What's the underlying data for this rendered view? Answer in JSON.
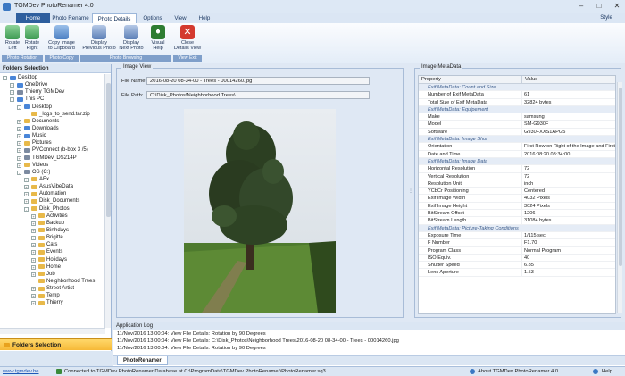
{
  "window": {
    "title": "TGMDev PhotoRenamer 4.0"
  },
  "menu": {
    "tabs": [
      {
        "label": "Home"
      },
      {
        "label": "Photo Rename"
      },
      {
        "label": "Photo Details"
      },
      {
        "label": "Options"
      },
      {
        "label": "View"
      },
      {
        "label": "Help"
      }
    ],
    "style_label": "Style"
  },
  "ribbon": {
    "buttons": [
      {
        "label1": "Rotate",
        "label2": "Left"
      },
      {
        "label1": "Rotate",
        "label2": "Right"
      },
      {
        "label1": "Copy Image",
        "label2": "to Clipboard"
      },
      {
        "label1": "Display",
        "label2": "Previous Photo"
      },
      {
        "label1": "Display",
        "label2": "Next Photo"
      },
      {
        "label1": "Visual",
        "label2": "Help"
      },
      {
        "label1": "Close",
        "label2": "Details View"
      }
    ],
    "groups": [
      {
        "label": "Photo Rotation"
      },
      {
        "label": "Photo Copy"
      },
      {
        "label": "Photo Browsing"
      },
      {
        "label": "View Exit"
      }
    ]
  },
  "folders": {
    "header": "Folders Selection",
    "bottom_label": "Folders Selection",
    "tree": [
      {
        "label": "Desktop",
        "exp": "-",
        "color": "#4a86d8"
      },
      {
        "label": "OneDrive",
        "exp": "+",
        "color": "#4a86d8"
      },
      {
        "label": "Thierry TGMDev",
        "exp": "+",
        "color": "#7c8aa0"
      },
      {
        "label": "This PC",
        "exp": "-",
        "color": "#4a86d8"
      },
      {
        "label": "Desktop",
        "exp": "-",
        "color": "#4a86d8"
      },
      {
        "label": "_logs_to_send.tar.zip",
        "exp": "",
        "color": "#e8b94a"
      },
      {
        "label": "Documents",
        "exp": "+",
        "color": "#e8b94a"
      },
      {
        "label": "Downloads",
        "exp": "+",
        "color": "#4a86d8"
      },
      {
        "label": "Music",
        "exp": "+",
        "color": "#4a86d8"
      },
      {
        "label": "Pictures",
        "exp": "+",
        "color": "#e8b94a"
      },
      {
        "label": "PVConnect (b-box 3 /5)",
        "exp": "+",
        "color": "#7c8aa0"
      },
      {
        "label": "TGMDev_DS214P",
        "exp": "+",
        "color": "#7c8aa0"
      },
      {
        "label": "Videos",
        "exp": "+",
        "color": "#e8b94a"
      },
      {
        "label": "OS (C:)",
        "exp": "-",
        "color": "#7c8aa0"
      },
      {
        "label": "AEx",
        "exp": "+",
        "color": "#e8b94a"
      },
      {
        "label": "AsusVibeData",
        "exp": "+",
        "color": "#e8b94a"
      },
      {
        "label": "Automation",
        "exp": "+",
        "color": "#e8b94a"
      },
      {
        "label": "Disk_Documents",
        "exp": "+",
        "color": "#e8b94a"
      },
      {
        "label": "Disk_Photos",
        "exp": "-",
        "color": "#e8b94a"
      },
      {
        "label": "Activities",
        "exp": "+",
        "color": "#e8b94a"
      },
      {
        "label": "Backup",
        "exp": "+",
        "color": "#e8b94a"
      },
      {
        "label": "Birthdays",
        "exp": "+",
        "color": "#e8b94a"
      },
      {
        "label": "Brigitte",
        "exp": "+",
        "color": "#e8b94a"
      },
      {
        "label": "Cats",
        "exp": "+",
        "color": "#e8b94a"
      },
      {
        "label": "Events",
        "exp": "+",
        "color": "#e8b94a"
      },
      {
        "label": "Holidays",
        "exp": "+",
        "color": "#e8b94a"
      },
      {
        "label": "Home",
        "exp": "+",
        "color": "#e8b94a"
      },
      {
        "label": "Job",
        "exp": "+",
        "color": "#e8b94a"
      },
      {
        "label": "Neighborhood Trees",
        "exp": "",
        "color": "#e8b94a"
      },
      {
        "label": "Street Artist",
        "exp": "+",
        "color": "#e8b94a"
      },
      {
        "label": "Temp",
        "exp": "+",
        "color": "#e8b94a"
      },
      {
        "label": "Thierry",
        "exp": "+",
        "color": "#e8b94a"
      }
    ]
  },
  "image_view": {
    "title": "Image View",
    "file_name_label": "File Name:",
    "file_name": "2016-08-20 08-34-00 - Trees - 00014260.jpg",
    "file_path_label": "File Path:",
    "file_path": "C:\\Disk_Photos\\Neighborhood Trees\\"
  },
  "metadata": {
    "title": "Image MetaData",
    "col_property": "Property",
    "col_value": "Value",
    "rows": [
      {
        "section": "Exif MetaData: Count and Size"
      },
      {
        "p": "Number of Exif MetaData",
        "v": "61"
      },
      {
        "p": "Total Size of Exif MetaData",
        "v": "32824 bytes"
      },
      {
        "section": "Exif MetaData: Equipement"
      },
      {
        "p": "Make",
        "v": "samsung"
      },
      {
        "p": "Model",
        "v": "SM-G930F"
      },
      {
        "p": "Software",
        "v": "G930FXXS1APG5"
      },
      {
        "section": "Exif MetaData: Image Shot"
      },
      {
        "p": "Orientation",
        "v": "First Row on Right of the Image and First..."
      },
      {
        "p": "Date and Time",
        "v": "2016:08:20 08:34:00"
      },
      {
        "section": "Exif MetaData: Image Data"
      },
      {
        "p": "Horizontal Resolution",
        "v": "72"
      },
      {
        "p": "Vertical Resolution",
        "v": "72"
      },
      {
        "p": "Resolution Unit",
        "v": "inch"
      },
      {
        "p": "YCbCr Positioning",
        "v": "Centered"
      },
      {
        "p": "Exif Image Width",
        "v": "4032 Pixels"
      },
      {
        "p": "Exif Image Height",
        "v": "3024 Pixels"
      },
      {
        "p": "BitStream Offset",
        "v": "1206"
      },
      {
        "p": "BitStream Length",
        "v": "31084 bytes"
      },
      {
        "section": "Exif MetaData: Picture-Taking Conditions"
      },
      {
        "p": "Exposure Time",
        "v": "1/115 sec."
      },
      {
        "p": "F Number",
        "v": "F1.70"
      },
      {
        "p": "Program Class",
        "v": "Normal Program"
      },
      {
        "p": "ISO Equiv.",
        "v": "40"
      },
      {
        "p": "Shutter Speed",
        "v": "6.85"
      },
      {
        "p": "Lens Aperture",
        "v": "1.53"
      }
    ]
  },
  "log": {
    "title": "Application Log",
    "lines": [
      "11/Nov/2016 13:00:04: View File Details: Rotation by 90 Degrees",
      "11/Nov/2016 13:00:04: View File Details: C:\\Disk_Photos\\Neighborhood Trees\\2016-08-20 08-34-00 - Trees - 00014260.jpg",
      "11/Nov/2016 13:00:04: View File Details: Rotation by 90 Degrees"
    ],
    "tab_label": "PhotoRenamer"
  },
  "status": {
    "link": "www.tgmdev.be",
    "connection": "Connected to TGMDev PhotoRenamer Database at C:\\ProgramData\\TGMDev PhotoRenamer\\PhotoRenamer.sq3",
    "about": "About TGMDev PhotoRenamer 4.0",
    "help": "Help"
  }
}
